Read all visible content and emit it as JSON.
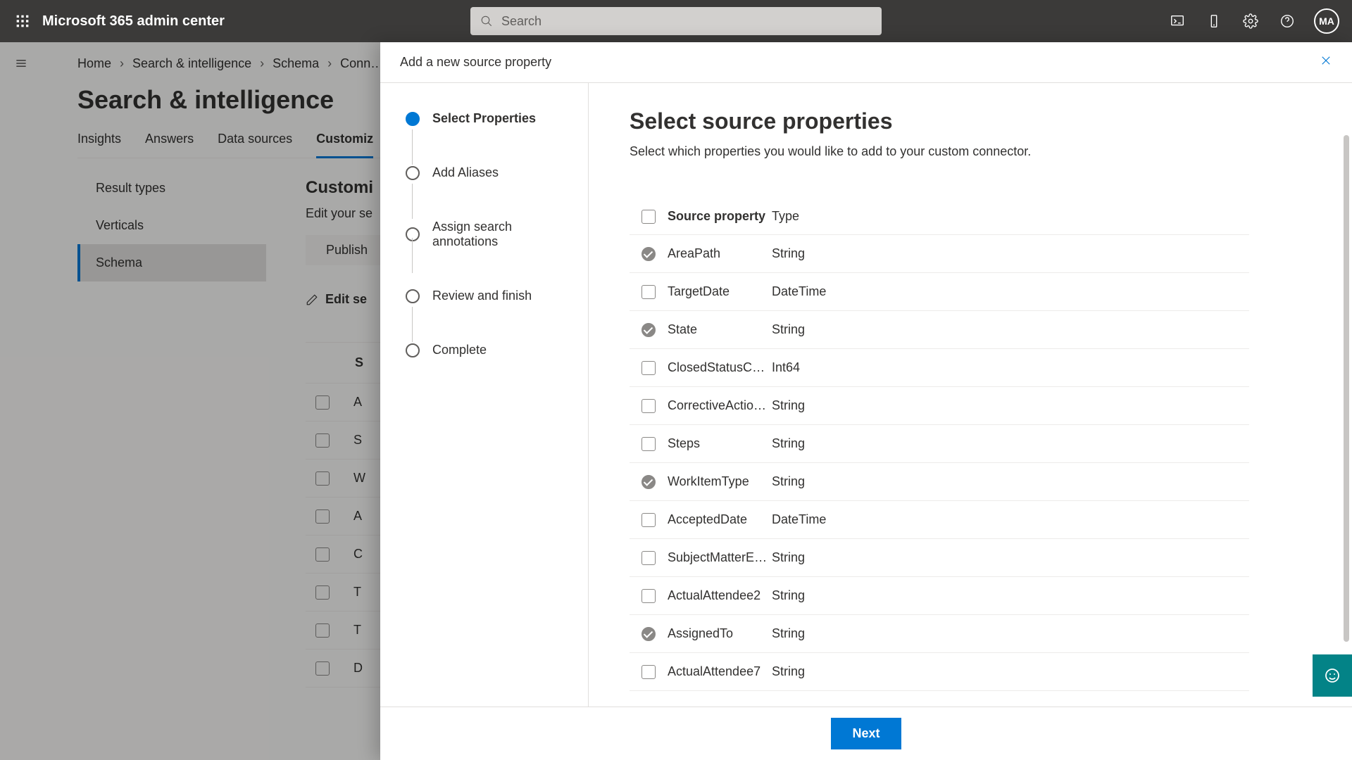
{
  "header": {
    "app_title": "Microsoft 365 admin center",
    "search_placeholder": "Search",
    "avatar_initials": "MA"
  },
  "breadcrumb": [
    "Home",
    "Search & intelligence",
    "Schema",
    "Conn…"
  ],
  "page": {
    "title": "Search & intelligence",
    "tabs": [
      "Insights",
      "Answers",
      "Data sources",
      "Customiz"
    ],
    "active_tab": 3,
    "sidenav": [
      "Result types",
      "Verticals",
      "Schema"
    ],
    "sidenav_active": 2,
    "section_title": "Customi",
    "section_sub": "Edit your se",
    "publish_label": "Publish",
    "edit_semantic_label": "Edit se",
    "bg_table_header": "S",
    "bg_rows": [
      "A",
      "S",
      "W",
      "A",
      "C",
      "T",
      "T",
      "D"
    ]
  },
  "flyout": {
    "title": "Add a new source property",
    "steps": [
      {
        "label": "Select Properties",
        "current": true
      },
      {
        "label": "Add Aliases",
        "current": false
      },
      {
        "label": "Assign search annotations",
        "current": false
      },
      {
        "label": "Review and finish",
        "current": false
      },
      {
        "label": "Complete",
        "current": false
      }
    ],
    "main_title": "Select source properties",
    "main_sub": "Select which properties you would like to add to your custom connector.",
    "columns": {
      "name": "Source property",
      "type": "Type"
    },
    "rows": [
      {
        "name": "AreaPath",
        "type": "String",
        "checked": true
      },
      {
        "name": "TargetDate",
        "type": "DateTime",
        "checked": false
      },
      {
        "name": "State",
        "type": "String",
        "checked": true
      },
      {
        "name": "ClosedStatusCode",
        "type": "Int64",
        "checked": false
      },
      {
        "name": "CorrectiveAction…",
        "type": "String",
        "checked": false
      },
      {
        "name": "Steps",
        "type": "String",
        "checked": false
      },
      {
        "name": "WorkItemType",
        "type": "String",
        "checked": true
      },
      {
        "name": "AcceptedDate",
        "type": "DateTime",
        "checked": false
      },
      {
        "name": "SubjectMatterEx…",
        "type": "String",
        "checked": false
      },
      {
        "name": "ActualAttendee2",
        "type": "String",
        "checked": false
      },
      {
        "name": "AssignedTo",
        "type": "String",
        "checked": true
      },
      {
        "name": "ActualAttendee7",
        "type": "String",
        "checked": false
      }
    ],
    "next_label": "Next"
  }
}
